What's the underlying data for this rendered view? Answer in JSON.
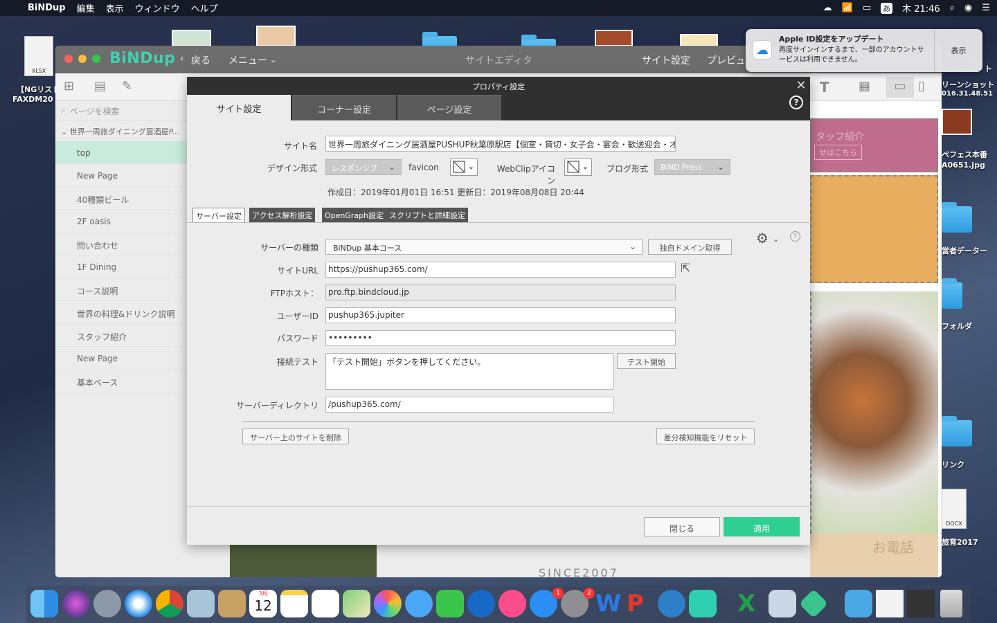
{
  "menubar": {
    "app_name": "BiNDup",
    "items": [
      "編集",
      "表示",
      "ウィンドウ",
      "ヘルプ"
    ],
    "clock": "木 21:46",
    "input_mode": "あ"
  },
  "desktop": {
    "xlsx_label": "XLSX",
    "xlsx_name": "【NGリスト",
    "xlsx_name2": "FAXDM20",
    "right_labels": [
      "ト",
      "リーンショット",
      "016.31.48.51",
      "ペフェス本番",
      "A0651.jpg",
      "営者データー",
      "フォルダ",
      "リンク",
      "DOCX",
      "旅育2017"
    ]
  },
  "notification": {
    "title": "Apple ID設定をアップデート",
    "body": "再度サインインするまで、一部のアカウントサービスは利用できません。",
    "action": "表示"
  },
  "window": {
    "logo": "BiNDup",
    "back": "戻る",
    "menu": "メニュー",
    "editor": "サイトエディタ",
    "site_settings": "サイト設定",
    "preview": "プレビュ"
  },
  "sidebar": {
    "search_placeholder": "ページを検索",
    "site": "世界一周旅ダイニング居酒屋P...",
    "pages": [
      "top",
      "New Page",
      "40種類ビール",
      "2F oasis",
      "問い合わせ",
      "1F Dining",
      "コース説明",
      "世界の料理&ドリンク説明",
      "スタッフ紹介",
      "New Page",
      "基本ベース"
    ]
  },
  "preview": {
    "staff_text": "タッフ紹介",
    "staff_btn": "せはこちら",
    "phone_text": "お電話",
    "since": "SINCE2007"
  },
  "dialog": {
    "title": "プロパティ設定",
    "tabs": [
      "サイト設定",
      "コーナー設定",
      "ページ設定"
    ],
    "site_name_label": "サイト名",
    "site_name_value": "世界一周旅ダイニング居酒屋PUSHUP秋葉原駅店【個室・貸切・女子会・宴会・歓送迎会・オ",
    "design_label": "デザイン形式",
    "design_value": "レスポンシブ",
    "favicon_label": "favicon",
    "webclip_label": "WebClipアイコン",
    "blog_label": "ブログ形式",
    "blog_value": "BiND Press",
    "dates": "作成日：2019年01月01日 16:51  更新日：2019年08月08日 20:44",
    "subtabs": [
      "サーバー設定",
      "アクセス解析設定",
      "OpenGraph設定",
      "スクリプトと詳細設定"
    ],
    "server_type_label": "サーバーの種類",
    "server_type_value": "BiNDup 基本コース",
    "domain_btn": "独自ドメイン取得",
    "url_label": "サイトURL",
    "url_value": "https://pushup365.com/",
    "ftp_label": "FTPホスト：",
    "ftp_value": "pro.ftp.bindcloud.jp",
    "user_label": "ユーザーID",
    "user_value": "pushup365.jupiter",
    "pass_label": "パスワード",
    "pass_value": "•••••••••",
    "test_label": "接続テスト",
    "test_value": "「テスト開始」ボタンを押してください。",
    "test_btn": "テスト開始",
    "dir_label": "サーバーディレクトリ",
    "dir_value": "/pushup365.com/",
    "delete_btn": "サーバー上のサイトを削除",
    "reset_btn": "差分検知機能をリセット",
    "close_btn": "閉じる",
    "apply_btn": "適用"
  },
  "dock": {
    "calendar_month": "3月",
    "calendar_day": "12",
    "badge_appstore": "1",
    "badge_prefs": "2"
  },
  "colors": {
    "accent": "#2fcf92",
    "logo": "#3fd1b0",
    "dialog_header": "#303030"
  }
}
